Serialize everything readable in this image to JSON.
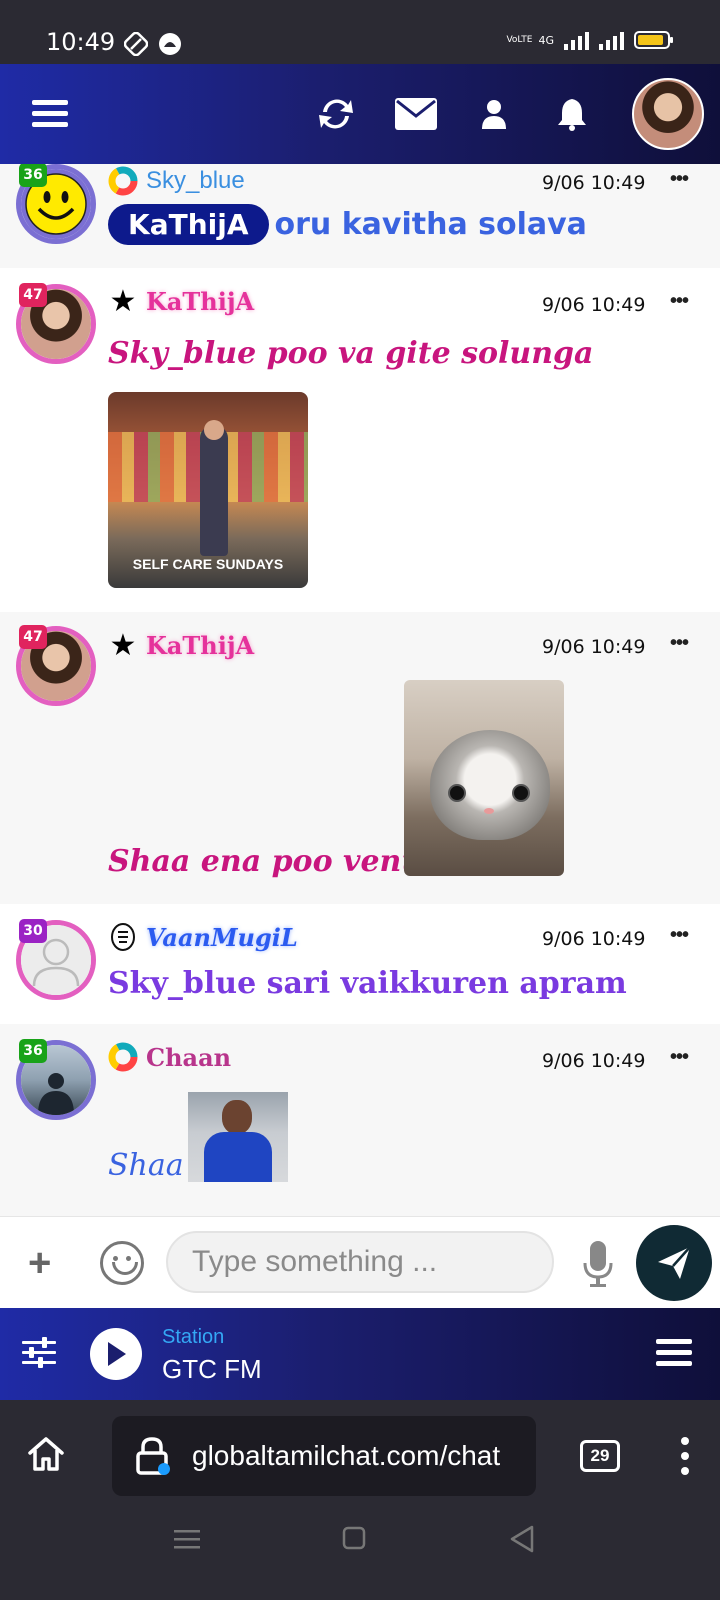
{
  "status_bar": {
    "time": "10:49",
    "volte_label": "VoLTE",
    "network_label": "4G",
    "icons": [
      "nfc-icon",
      "notification-icon",
      "signal-icon",
      "battery-icon"
    ]
  },
  "top_nav": {
    "icons": [
      "menu-icon",
      "refresh-icon",
      "mail-icon",
      "user-icon",
      "bell-icon",
      "profile-avatar"
    ]
  },
  "messages": [
    {
      "level": "36",
      "level_color": "#19a319",
      "username": "Sky_blue",
      "username_color": "#3a8fe0",
      "timestamp": "9/06 10:49",
      "mention": "KaThijA",
      "text": "oru kavitha solava",
      "text_color": "#3a63e0",
      "has_image": false
    },
    {
      "level": "47",
      "level_color": "#e0245e",
      "username": "KaThijA",
      "username_color": "#e5329b",
      "timestamp": "9/06 10:49",
      "text": "Sky_blue poo va gite solunga",
      "text_color": "#c8157e",
      "image_caption": "SELF CARE SUNDAYS"
    },
    {
      "level": "47",
      "level_color": "#e0245e",
      "username": "KaThijA",
      "username_color": "#e5329b",
      "timestamp": "9/06 10:49",
      "text": "Shaa ena poo venum",
      "text_color": "#c8157e"
    },
    {
      "level": "30",
      "level_color": "#9b23c4",
      "username": "VaanMugiL",
      "username_color": "#2b5bf0",
      "timestamp": "9/06 10:49",
      "text": "Sky_blue sari vaikkuren apram",
      "text_color": "#7a3ae0"
    },
    {
      "level": "36",
      "level_color": "#19a319",
      "username": "Chaan",
      "username_color": "#b8358c",
      "timestamp": "9/06 10:49",
      "text": "Shaa",
      "text_color": "#3a63e0"
    }
  ],
  "composer": {
    "placeholder": "Type something ..."
  },
  "radio": {
    "station_label": "Station",
    "station_name": "GTC FM"
  },
  "browser": {
    "url": "globaltamilchat.com/chat",
    "tab_count": "29"
  }
}
